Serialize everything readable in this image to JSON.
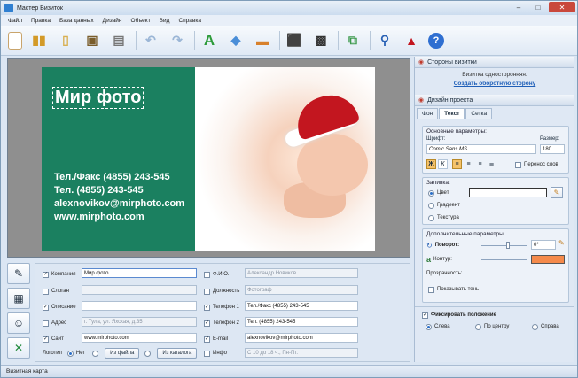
{
  "window": {
    "title": "Мастер Визиток"
  },
  "menu": [
    "Файл",
    "Правка",
    "База данных",
    "Дизайн",
    "Объект",
    "Вид",
    "Справка"
  ],
  "toolbar_icons": [
    "new-icon",
    "open-icon",
    "templates-icon",
    "save-icon",
    "print-icon",
    "undo-icon",
    "redo-icon",
    "text-icon",
    "shapes-icon",
    "image-icon",
    "map-icon",
    "qrcode-icon",
    "crop-icon",
    "zoom-icon",
    "hat-icon",
    "help-icon"
  ],
  "card": {
    "title": "Мир фото",
    "lines": [
      "Тел./Факс (4855) 243-545",
      "Тел. (4855) 243-545",
      "alexnovikov@mirphoto.com",
      "www.mirphoto.com"
    ],
    "colors": {
      "green": "#1b8060"
    }
  },
  "form": {
    "left": [
      {
        "label": "Компания",
        "value": "Мир фото",
        "checked": true
      },
      {
        "label": "Слоган",
        "value": "",
        "checked": false
      },
      {
        "label": "Описание",
        "value": "",
        "checked": true
      },
      {
        "label": "Адрес",
        "value": "г. Тула, ул. Яхская, д.35",
        "checked": false
      },
      {
        "label": "Сайт",
        "value": "www.mirphoto.com",
        "checked": true
      }
    ],
    "right": [
      {
        "label": "Ф.И.О.",
        "value": "Александр Новиков",
        "checked": false
      },
      {
        "label": "Должность",
        "value": "Фотограф",
        "checked": false
      },
      {
        "label": "Телефон 1",
        "value": "Тел./Факс (4855) 243-545",
        "checked": true
      },
      {
        "label": "Телефон 2",
        "value": "Тел. (4855) 243-545",
        "checked": true
      },
      {
        "label": "E-mail",
        "value": "alexnovikov@mirphoto.com",
        "checked": true
      },
      {
        "label": "Инфо",
        "value": "С 10 до 18 ч., Пн-Пт.",
        "checked": false
      }
    ],
    "logo_label": "Логотип",
    "logo_none": "Нет",
    "logo_from_file": "Из файла",
    "logo_from_catalog": "Из каталога"
  },
  "right_panel": {
    "sides_header": "Стороны визитки",
    "sides_info": "Визитка односторонняя.",
    "create_back_link": "Создать оборотную сторону",
    "design_header": "Дизайн проекта",
    "tabs": [
      "Фон",
      "Текст",
      "Сетка"
    ],
    "basic_title": "Основные параметры:",
    "font_label": "Шрифт:",
    "font_value": "Comic Sans MS",
    "size_label": "Размер:",
    "size_value": "180",
    "wrap_label": "Перенос слов",
    "fill_title": "Заливка:",
    "fill_color": "Цвет",
    "fill_gradient": "Градиент",
    "fill_texture": "Текстура",
    "extra_title": "Дополнительные параметры:",
    "rotation_label": "Поворот:",
    "rotation_value": "0°",
    "outline_label": "Контур:",
    "outline_color": "#f58a4b",
    "transparency_label": "Прозрачность:",
    "shadow_label": "Показывать тень",
    "fix_label": "Фиксировать положение",
    "pos_left": "Слева",
    "pos_center": "По центру",
    "pos_right": "Справа"
  },
  "status": "Визитная карта"
}
